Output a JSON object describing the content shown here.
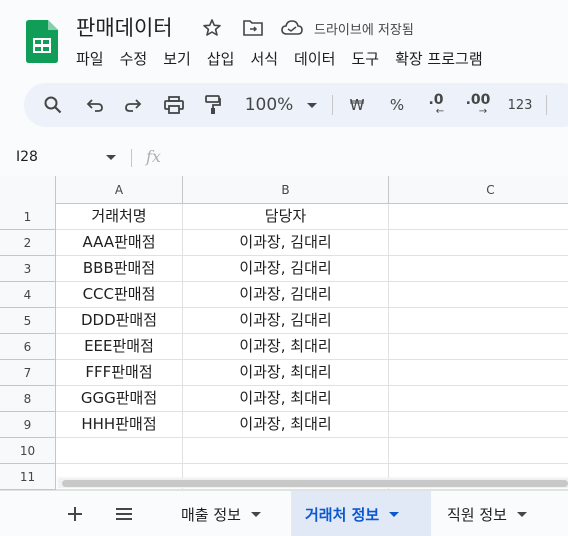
{
  "header": {
    "title": "판매데이터",
    "saved_status": "드라이브에 저장됨",
    "menu": [
      "파일",
      "수정",
      "보기",
      "삽입",
      "서식",
      "데이터",
      "도구",
      "확장 프로그램"
    ]
  },
  "toolbar": {
    "zoom": "100%",
    "currency": "₩",
    "percent": "%",
    "decrease_decimal": ".0",
    "increase_decimal": ".00",
    "number_format": "123"
  },
  "formula_bar": {
    "name_box": "I28",
    "fx_label": "fx"
  },
  "grid": {
    "columns": [
      "A",
      "B",
      "C"
    ],
    "rows": [
      {
        "num": "1",
        "a": "거래처명",
        "b": "담당자",
        "c": ""
      },
      {
        "num": "2",
        "a": "AAA판매점",
        "b": "이과장, 김대리",
        "c": ""
      },
      {
        "num": "3",
        "a": "BBB판매점",
        "b": "이과장, 김대리",
        "c": ""
      },
      {
        "num": "4",
        "a": "CCC판매점",
        "b": "이과장, 김대리",
        "c": ""
      },
      {
        "num": "5",
        "a": "DDD판매점",
        "b": "이과장, 김대리",
        "c": ""
      },
      {
        "num": "6",
        "a": "EEE판매점",
        "b": "이과장, 최대리",
        "c": ""
      },
      {
        "num": "7",
        "a": "FFF판매점",
        "b": "이과장, 최대리",
        "c": ""
      },
      {
        "num": "8",
        "a": "GGG판매점",
        "b": "이과장, 최대리",
        "c": ""
      },
      {
        "num": "9",
        "a": "HHH판매점",
        "b": "이과장, 최대리",
        "c": ""
      },
      {
        "num": "10",
        "a": "",
        "b": "",
        "c": ""
      },
      {
        "num": "11",
        "a": "",
        "b": "",
        "c": ""
      }
    ]
  },
  "sheets": {
    "tabs": [
      {
        "label": "매출 정보",
        "active": false
      },
      {
        "label": "거래처 정보",
        "active": true
      },
      {
        "label": "직원 정보",
        "active": false
      }
    ]
  },
  "colors": {
    "brand_green": "#0f9d58",
    "active_tab": "#0b57d0",
    "toolbar_bg": "#edf2fa"
  }
}
